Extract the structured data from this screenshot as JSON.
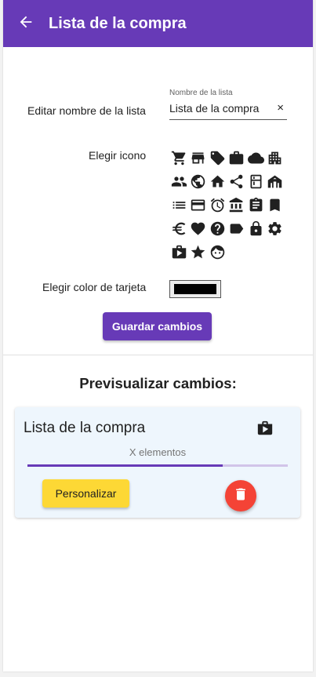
{
  "appbar": {
    "title": "Lista de la compra",
    "back_icon": "arrow-back-icon",
    "color": "#673ab7"
  },
  "form": {
    "name_label": "Editar nombre de la lista",
    "name_field": {
      "floating_label": "Nombre de la lista",
      "value": "Lista de la compra",
      "clear_icon": "×"
    },
    "icon_label": "Elegir icono",
    "icons": [
      "shopping-cart-icon",
      "store-icon",
      "tag-icon",
      "briefcase-icon",
      "cloud-icon",
      "apartment-icon",
      "people-icon",
      "globe-icon",
      "home-icon",
      "share-icon",
      "kitchen-icon",
      "house-fence-icon",
      "list-icon",
      "credit-card-icon",
      "alarm-icon",
      "bank-icon",
      "clipboard-icon",
      "bookmark-icon",
      "euro-icon",
      "heart-icon",
      "help-icon",
      "label-icon",
      "lock-icon",
      "settings-icon",
      "shop-bag-icon",
      "star-icon",
      "face-icon"
    ],
    "color_label": "Elegir color de tarjeta",
    "selected_color": "#000000",
    "save_button": "Guardar cambios"
  },
  "preview": {
    "heading": "Previsualizar cambios:",
    "card": {
      "title": "Lista de la compra",
      "icon": "shop-bag-icon",
      "count_text": "X elementos",
      "progress": 0.75,
      "customize_button": "Personalizar",
      "delete_icon": "trash-icon"
    }
  },
  "colors": {
    "primary": "#673ab7",
    "accent_yellow": "#fdd835",
    "danger": "#f44336",
    "card_bg": "#eef6fd"
  }
}
